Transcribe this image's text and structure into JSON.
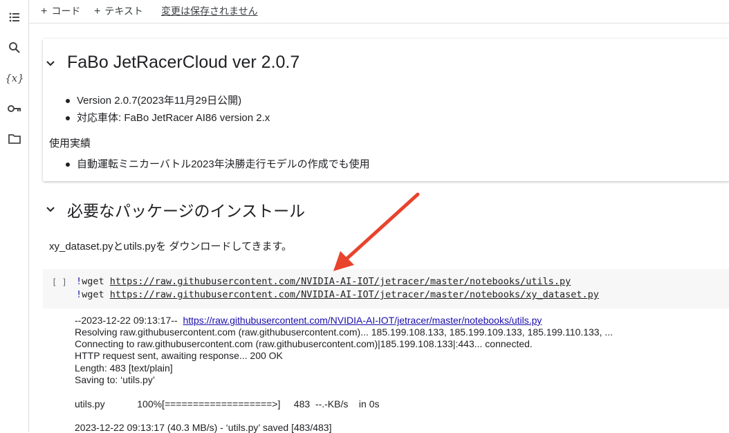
{
  "topbar": {
    "add_code_label": "コード",
    "add_text_label": "テキスト",
    "unsaved_label": "変更は保存されません"
  },
  "sidebar": {
    "icons": [
      "toc-icon",
      "search-icon",
      "variables-icon",
      "key-icon",
      "folder-icon"
    ],
    "variables_glyph": "{x}"
  },
  "cell1": {
    "title": "FaBo JetRacerCloud ver 2.0.7",
    "bullets": [
      "Version 2.0.7(2023年11月29日公開)",
      "対応車体: FaBo JetRacer AI86 version 2.x"
    ],
    "subheading": "使用実績",
    "usage_bullets": [
      "自動運転ミニカーバトル2023年決勝走行モデルの作成でも使用"
    ]
  },
  "section2": {
    "title": "必要なパッケージのインストール",
    "description": "xy_dataset.pyとutils.pyを ダウンロードしてきます。"
  },
  "code_cell": {
    "run_bracket": "[ ]",
    "lines": [
      {
        "bang": "!",
        "cmd": "wget ",
        "url": "https://raw.githubusercontent.com/NVIDIA-AI-IOT/jetracer/master/notebooks/utils.py"
      },
      {
        "bang": "!",
        "cmd": "wget ",
        "url": "https://raw.githubusercontent.com/NVIDIA-AI-IOT/jetracer/master/notebooks/xy_dataset.py"
      }
    ]
  },
  "output": {
    "line1_prefix": "--2023-12-22 09:13:17--  ",
    "line1_url": "https://raw.githubusercontent.com/NVIDIA-AI-IOT/jetracer/master/notebooks/utils.py",
    "lines": [
      "Resolving raw.githubusercontent.com (raw.githubusercontent.com)... 185.199.108.133, 185.199.109.133, 185.199.110.133, ...",
      "Connecting to raw.githubusercontent.com (raw.githubusercontent.com)|185.199.108.133|:443... connected.",
      "HTTP request sent, awaiting response... 200 OK",
      "Length: 483 [text/plain]",
      "Saving to: ‘utils.py’"
    ],
    "progress_line": "utils.py            100%[===================>]     483  --.-KB/s    in 0s",
    "saved_line": "2023-12-22 09:13:17 (40.3 MB/s) - ‘utils.py’ saved [483/483]"
  },
  "colors": {
    "arrow": "#e8432d",
    "link": "#1a0dab",
    "code_bg": "#f7f7f7"
  }
}
